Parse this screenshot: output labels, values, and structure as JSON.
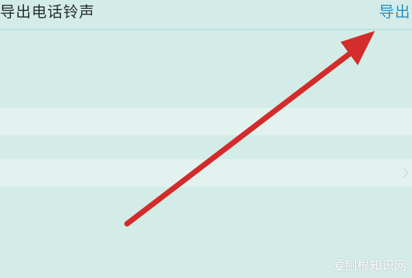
{
  "nav": {
    "title": "导出电话铃声",
    "faint_text": "",
    "action_label": "导出"
  },
  "rows": [
    {
      "label": ""
    },
    {
      "label": "",
      "icon": "chevron-right-icon"
    }
  ],
  "annotation": {
    "icon": "red-arrow-icon",
    "color": "#d42b2b"
  },
  "watermark": {
    "text": "爱刨根知识网"
  },
  "colors": {
    "background": "#d3ece7",
    "row": "#e2f2ef",
    "action": "#2d8fc0",
    "title": "#2a2f2e"
  }
}
